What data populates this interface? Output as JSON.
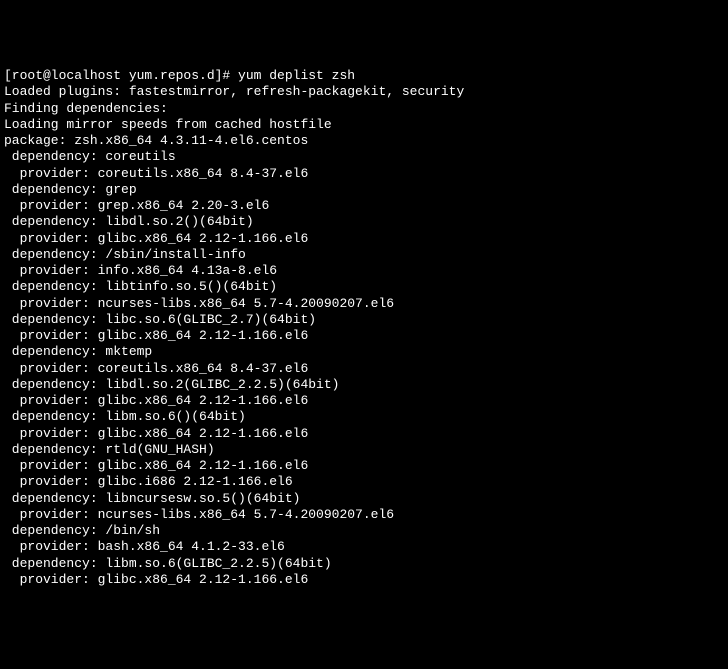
{
  "prompt": "[root@localhost yum.repos.d]# yum deplist zsh",
  "loaded_plugins": "Loaded plugins: fastestmirror, refresh-packagekit, security",
  "finding": "Finding dependencies:",
  "loading_mirror": "Loading mirror speeds from cached hostfile",
  "package": "package: zsh.x86_64 4.3.11-4.el6.centos",
  "deps": [
    {
      "dep": " dependency: coreutils",
      "providers": [
        "  provider: coreutils.x86_64 8.4-37.el6"
      ]
    },
    {
      "dep": " dependency: grep",
      "providers": [
        "  provider: grep.x86_64 2.20-3.el6"
      ]
    },
    {
      "dep": " dependency: libdl.so.2()(64bit)",
      "providers": [
        "  provider: glibc.x86_64 2.12-1.166.el6"
      ]
    },
    {
      "dep": " dependency: /sbin/install-info",
      "providers": [
        "  provider: info.x86_64 4.13a-8.el6"
      ]
    },
    {
      "dep": " dependency: libtinfo.so.5()(64bit)",
      "providers": [
        "  provider: ncurses-libs.x86_64 5.7-4.20090207.el6"
      ]
    },
    {
      "dep": " dependency: libc.so.6(GLIBC_2.7)(64bit)",
      "providers": [
        "  provider: glibc.x86_64 2.12-1.166.el6"
      ]
    },
    {
      "dep": " dependency: mktemp",
      "providers": [
        "  provider: coreutils.x86_64 8.4-37.el6"
      ]
    },
    {
      "dep": " dependency: libdl.so.2(GLIBC_2.2.5)(64bit)",
      "providers": [
        "  provider: glibc.x86_64 2.12-1.166.el6"
      ]
    },
    {
      "dep": " dependency: libm.so.6()(64bit)",
      "providers": [
        "  provider: glibc.x86_64 2.12-1.166.el6"
      ]
    },
    {
      "dep": " dependency: rtld(GNU_HASH)",
      "providers": [
        "  provider: glibc.x86_64 2.12-1.166.el6",
        "  provider: glibc.i686 2.12-1.166.el6"
      ]
    },
    {
      "dep": " dependency: libncursesw.so.5()(64bit)",
      "providers": [
        "  provider: ncurses-libs.x86_64 5.7-4.20090207.el6"
      ]
    },
    {
      "dep": " dependency: /bin/sh",
      "providers": [
        "  provider: bash.x86_64 4.1.2-33.el6"
      ]
    },
    {
      "dep": " dependency: libm.so.6(GLIBC_2.2.5)(64bit)",
      "providers": [
        "  provider: glibc.x86_64 2.12-1.166.el6"
      ]
    }
  ]
}
